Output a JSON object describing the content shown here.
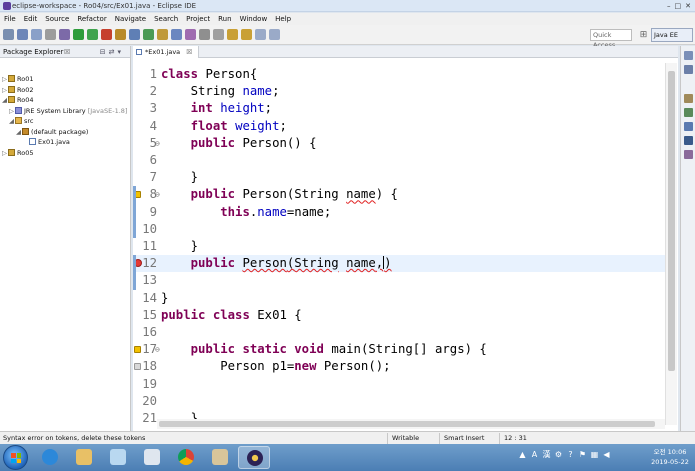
{
  "window": {
    "title": "eclipse-workspace - Ro04/src/Ex01.java - Eclipse IDE",
    "controls": [
      "–",
      "□",
      "✕"
    ]
  },
  "menu": {
    "items": [
      "File",
      "Edit",
      "Source",
      "Refactor",
      "Navigate",
      "Search",
      "Project",
      "Run",
      "Window",
      "Help"
    ]
  },
  "toolbar": {
    "quick_access_placeholder": "Quick Access",
    "perspective": "Java EE"
  },
  "package_explorer": {
    "title": "Package Explorer",
    "close": "☒",
    "tree": [
      {
        "label": "Ro01",
        "depth": 0,
        "expanded": false,
        "icon": "project-icon"
      },
      {
        "label": "Ro02",
        "depth": 0,
        "expanded": false,
        "icon": "project-icon"
      },
      {
        "label": "Ro04",
        "depth": 0,
        "expanded": true,
        "icon": "project-icon"
      },
      {
        "label": "JRE System Library",
        "extra": "[JavaSE-1.8]",
        "depth": 1,
        "expanded": false,
        "icon": "library-icon"
      },
      {
        "label": "src",
        "depth": 1,
        "expanded": true,
        "icon": "source-folder-icon"
      },
      {
        "label": "(default package)",
        "depth": 2,
        "expanded": true,
        "icon": "package-icon"
      },
      {
        "label": "Ex01.java",
        "depth": 3,
        "expanded": false,
        "icon": "java-file-icon"
      },
      {
        "label": "Ro05",
        "depth": 0,
        "expanded": false,
        "icon": "project-icon"
      }
    ]
  },
  "editor": {
    "tab_label": "*Ex01.java",
    "tab_close": "☒",
    "lines": [
      {
        "n": "1",
        "text": "class Person{"
      },
      {
        "n": "2",
        "text": "    String name;"
      },
      {
        "n": "3",
        "text": "    int height;"
      },
      {
        "n": "4",
        "text": "    float weight;"
      },
      {
        "n": "5",
        "text": "    public Person() {",
        "fold": "⊖"
      },
      {
        "n": "6",
        "text": ""
      },
      {
        "n": "7",
        "text": "    }"
      },
      {
        "n": "8",
        "text": "    public Person(String name) {",
        "fold": "⊖",
        "marker": "warning"
      },
      {
        "n": "9",
        "text": "        this.name=name;"
      },
      {
        "n": "10",
        "text": ""
      },
      {
        "n": "11",
        "text": "    }"
      },
      {
        "n": "12",
        "text": "    public Person(String name,)",
        "marker": "error",
        "current": true
      },
      {
        "n": "13",
        "text": ""
      },
      {
        "n": "14",
        "text": "}"
      },
      {
        "n": "15",
        "text": "public class Ex01 {"
      },
      {
        "n": "16",
        "text": ""
      },
      {
        "n": "17",
        "text": "    public static void main(String[] args) {",
        "fold": "⊖",
        "marker": "warning"
      },
      {
        "n": "18",
        "text": "        Person p1=new Person();",
        "marker": "info"
      },
      {
        "n": "19",
        "text": ""
      },
      {
        "n": "20",
        "text": ""
      },
      {
        "n": "21",
        "text": "    }"
      }
    ]
  },
  "status": {
    "message": "Syntax error on tokens, delete these tokens",
    "mode": "Writable",
    "insert": "Smart Insert",
    "position": "12 : 31"
  },
  "taskbar": {
    "tray_lang": "A",
    "tray_ime": "漢",
    "time": "오전 10:06",
    "date": "2019-05-22"
  },
  "colors": {
    "keyword": "#7f0055",
    "field": "#0000c0",
    "current_line": "#e8f2fe",
    "error": "#e53935",
    "warning": "#f2c100"
  }
}
